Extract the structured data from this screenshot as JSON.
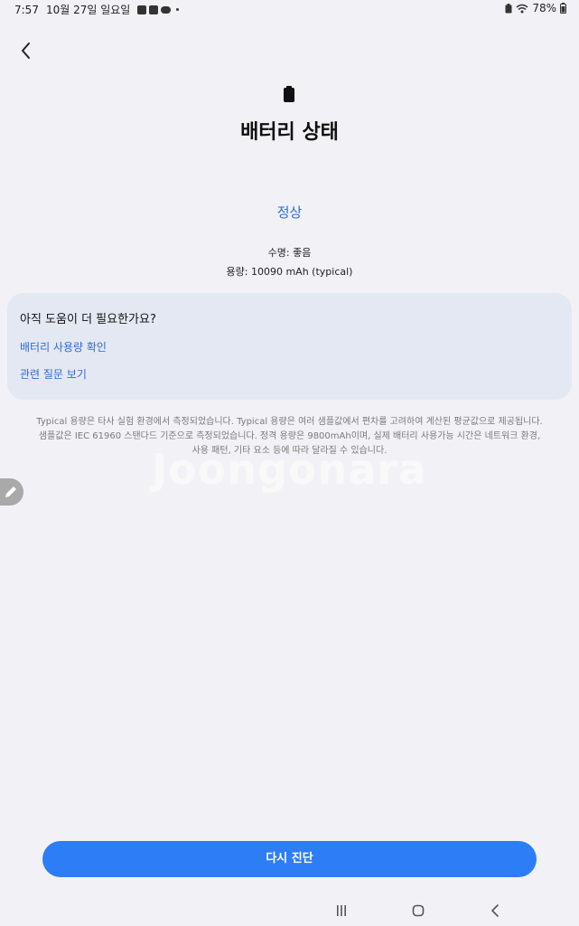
{
  "status_bar": {
    "time": "7:57",
    "date": "10월 27일 일요일",
    "battery_percent": "78%"
  },
  "page": {
    "title": "배터리 상태",
    "status": "정상",
    "lifespan": "수명: 좋음",
    "capacity": "용량: 10090 mAh (typical)"
  },
  "help": {
    "title": "아직 도움이 더 필요한가요?",
    "links": [
      "배터리 사용량 확인",
      "관련 질문 보기"
    ]
  },
  "disclaimer": {
    "line1": "Typical 용량은 타사 실험 환경에서 측정되었습니다. Typical 용량은 여러 샘플값에서 편차를 고려하여 계산된 평균값으로 제공됩니다.",
    "line2": "샘플값은 IEC 61960 스탠다드 기준으로 측정되었습니다. 정격 용량은 9800mAh이며, 실제 배터리 사용가능 시간은 네트워크 환경,",
    "line3": "사용 패턴, 기타 요소 등에 따라 달라질 수 있습니다."
  },
  "watermark": "Joongonara",
  "actions": {
    "rediagnose": "다시 진단"
  },
  "colors": {
    "accent": "#2f6ad9",
    "button": "#2d7df6",
    "card": "#e4e8f3",
    "background": "#f2f2f6"
  },
  "icons": [
    "back-arrow-icon",
    "battery-icon",
    "edit-pencil-icon",
    "recent-apps-icon",
    "home-icon",
    "nav-back-icon"
  ]
}
